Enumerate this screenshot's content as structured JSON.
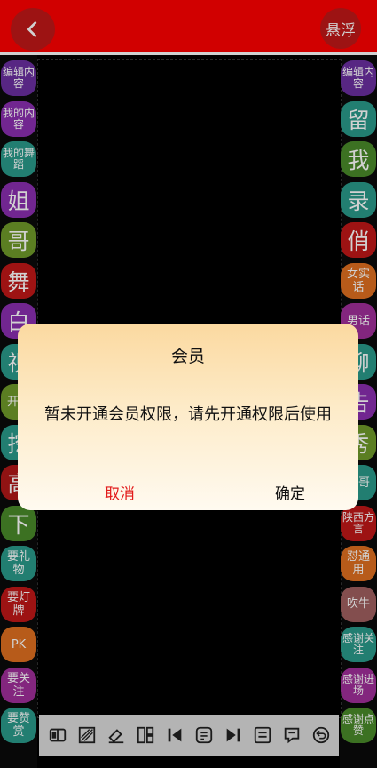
{
  "topbar": {
    "float_label": "悬浮"
  },
  "left_buttons": [
    {
      "label": "编辑内容",
      "bg": "#6b2fa0"
    },
    {
      "label": "我的内容",
      "bg": "#8a2fb0"
    },
    {
      "label": "我的舞蹈",
      "bg": "#2a9a8a"
    },
    {
      "label": "姐",
      "bg": "#8a2fb0"
    },
    {
      "label": "哥",
      "bg": "#6f9a2a"
    },
    {
      "label": "舞",
      "bg": "#c01818"
    },
    {
      "label": "白",
      "bg": "#8a2fb0"
    },
    {
      "label": "视",
      "bg": "#2a9a8a"
    },
    {
      "label": "开嗓",
      "bg": "#6f9a2a"
    },
    {
      "label": "挖",
      "bg": "#2a9a8a"
    },
    {
      "label": "高",
      "bg": "#b01818"
    },
    {
      "label": "下",
      "bg": "#4a8a2a"
    },
    {
      "label": "要礼物",
      "bg": "#2a9a8a"
    },
    {
      "label": "要灯牌",
      "bg": "#c01818"
    },
    {
      "label": "PK",
      "bg": "#e07020"
    },
    {
      "label": "要关注",
      "bg": "#a02f9a"
    },
    {
      "label": "要赞赏",
      "bg": "#2a9a8a"
    }
  ],
  "right_buttons": [
    {
      "label": "编辑内容",
      "bg": "#6b2fa0"
    },
    {
      "label": "留",
      "bg": "#2a9a8a"
    },
    {
      "label": "我",
      "bg": "#4a8a2a"
    },
    {
      "label": "录",
      "bg": "#2a9a8a"
    },
    {
      "label": "俏",
      "bg": "#c01818"
    },
    {
      "label": "女实话",
      "bg": "#e07020"
    },
    {
      "label": "男话",
      "bg": "#a02f9a"
    },
    {
      "label": "聊",
      "bg": "#2a9a8a"
    },
    {
      "label": "告",
      "bg": "#8a2fb0"
    },
    {
      "label": "秀",
      "bg": "#6f9a2a"
    },
    {
      "label": "白哥",
      "bg": "#2a9a8a"
    },
    {
      "label": "陕西方言",
      "bg": "#c01818"
    },
    {
      "label": "怼通用",
      "bg": "#e07020"
    },
    {
      "label": "吹牛",
      "bg": "#a06060"
    },
    {
      "label": "感谢关注",
      "bg": "#2a9a8a"
    },
    {
      "label": "感谢进场",
      "bg": "#a02f9a"
    },
    {
      "label": "感谢点赞",
      "bg": "#4a8a2a"
    }
  ],
  "toolbar_tools": [
    "mirror-icon",
    "crop-icon",
    "eraser-icon",
    "layout-icon",
    "skip-back-icon",
    "note-icon",
    "skip-forward-icon",
    "list-icon",
    "speech-icon",
    "undo-icon"
  ],
  "dialog": {
    "title": "会员",
    "message": "暂未开通会员权限，请先开通权限后使用",
    "cancel_label": "取消",
    "confirm_label": "确定"
  }
}
